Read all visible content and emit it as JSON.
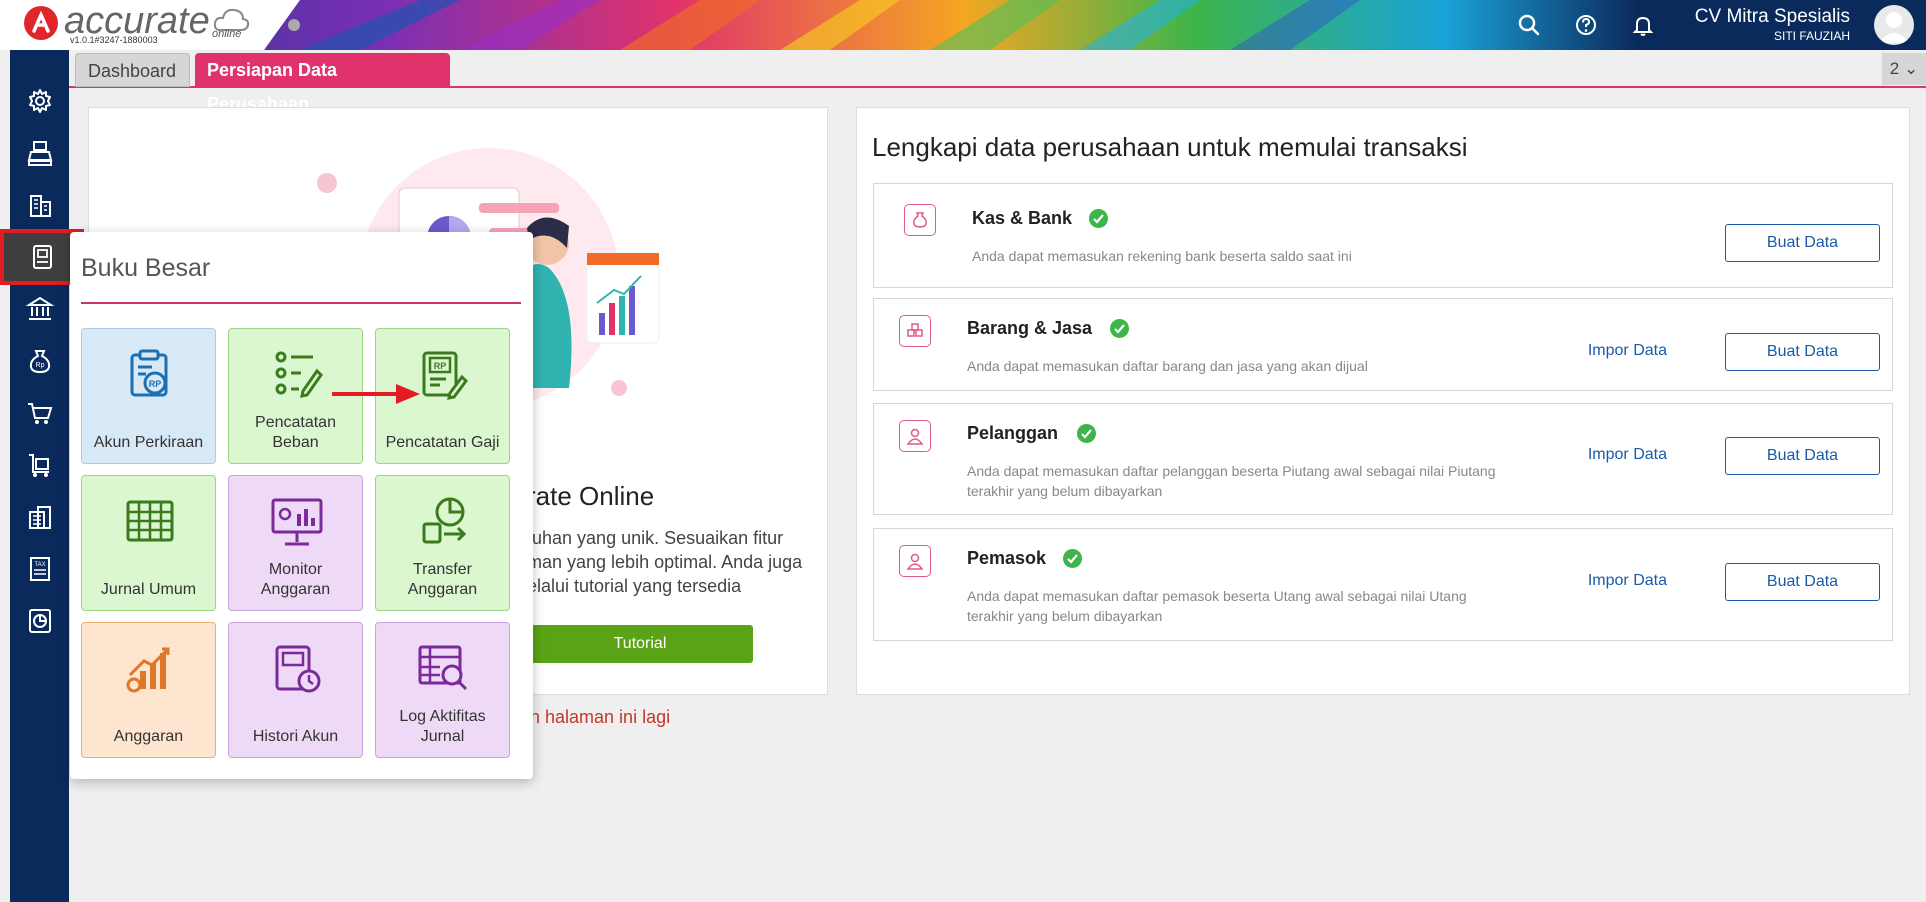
{
  "app": {
    "logo_text": "accurate",
    "logo_sub": "online",
    "version": "v1.0.1#3247-1880003"
  },
  "header": {
    "company": "CV Mitra Spesialis",
    "user": "SITI FAUZIAH",
    "icons": [
      "search-icon",
      "help-icon",
      "bell-icon"
    ]
  },
  "sidebar": {
    "items": [
      "gear-icon",
      "sales-icon",
      "building-icon",
      "ledger-book-icon",
      "bank-icon",
      "money-bag-icon",
      "cart-icon",
      "truck-cart-icon",
      "warehouse-icon",
      "tax-icon",
      "report-chart-icon"
    ],
    "active_index": 3
  },
  "tabs": {
    "dashboard": "Dashboard",
    "persiapan": "Persiapan Data Perusahaan",
    "count": "2"
  },
  "welcome": {
    "title_fragment": "rate Online",
    "desc_line1": "tuhan yang unik. Sesuaikan fitur",
    "desc_line2": "man yang lebih optimal. Anda juga",
    "desc_line3": "elalui tutorial yang tersedia",
    "tutorial_label": "Tutorial",
    "hide_link": "n halaman ini lagi"
  },
  "setup": {
    "title": "Lengkapi data perusahaan untuk memulai transaksi",
    "impor_label": "Impor Data",
    "buat_label": "Buat Data",
    "cards": [
      {
        "title": "Kas & Bank",
        "desc1": "Anda dapat memasukan rekening bank beserta saldo saat ini",
        "desc2": ""
      },
      {
        "title": "Barang & Jasa",
        "desc1": "Anda dapat memasukan daftar barang dan jasa yang akan dijual",
        "desc2": ""
      },
      {
        "title": "Pelanggan",
        "desc1": "Anda dapat memasukan daftar pelanggan beserta Piutang awal sebagai nilai Piutang",
        "desc2": "terakhir yang belum dibayarkan"
      },
      {
        "title": "Pemasok",
        "desc1": "Anda dapat memasukan daftar pemasok beserta Utang awal sebagai nilai Utang",
        "desc2": "terakhir yang belum dibayarkan"
      }
    ]
  },
  "flyout": {
    "title": "Buku Besar",
    "tiles": [
      {
        "label1": "Akun Perkiraan",
        "label2": ""
      },
      {
        "label1": "Pencatatan",
        "label2": "Beban"
      },
      {
        "label1": "Pencatatan Gaji",
        "label2": ""
      },
      {
        "label1": "Jurnal Umum",
        "label2": ""
      },
      {
        "label1": "Monitor",
        "label2": "Anggaran"
      },
      {
        "label1": "Transfer",
        "label2": "Anggaran"
      },
      {
        "label1": "Anggaran",
        "label2": ""
      },
      {
        "label1": "Histori Akun",
        "label2": ""
      },
      {
        "label1": "Log Aktifitas",
        "label2": "Jurnal"
      }
    ]
  },
  "colors": {
    "navy": "#0b2a5c",
    "accent_pink": "#e0336b",
    "green": "#5ba316",
    "link_blue": "#1c5aa8"
  }
}
